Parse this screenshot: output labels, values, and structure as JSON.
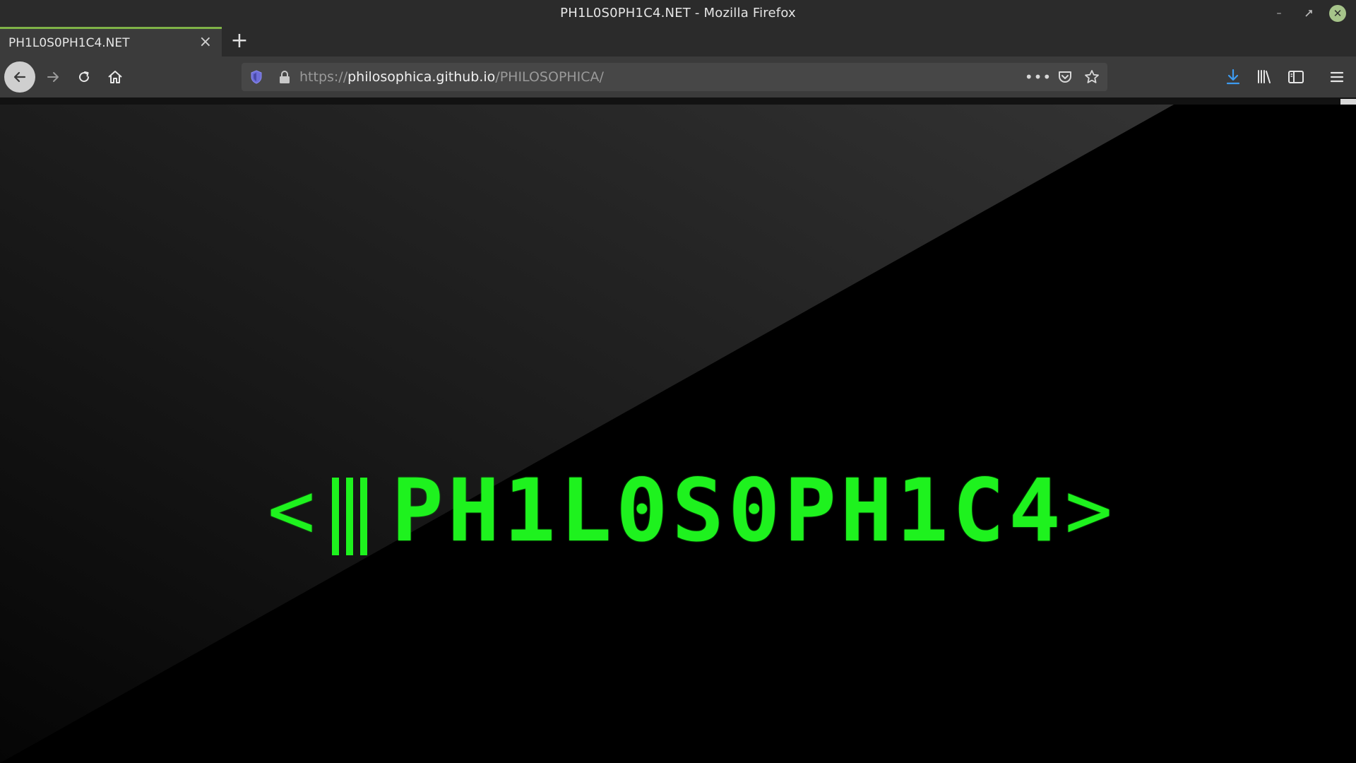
{
  "window": {
    "title": "PH1L0S0PH1C4.NET - Mozilla Firefox"
  },
  "tabs": [
    {
      "label": "PH1L0S0PH1C4.NET",
      "active": true
    }
  ],
  "navbar": {
    "url": {
      "scheme": "https://",
      "domain": "philosophica.github.io",
      "path": "/PHILOSOPHICA/"
    },
    "more_label": "•••",
    "icons": [
      "back-icon",
      "forward-icon",
      "reload-icon",
      "home-icon",
      "shield-icon",
      "lock-icon",
      "pocket-icon",
      "star-icon",
      "download-icon",
      "library-icon",
      "sidebar-icon",
      "menu-icon"
    ]
  },
  "page": {
    "logo": {
      "left": "<",
      "text": "PH1L0S0PH1C4",
      "right": ">"
    },
    "colors": {
      "accent": "#1ef21e",
      "background_dark": "#000000",
      "background_gradient_light": "#2e2e2e"
    }
  }
}
